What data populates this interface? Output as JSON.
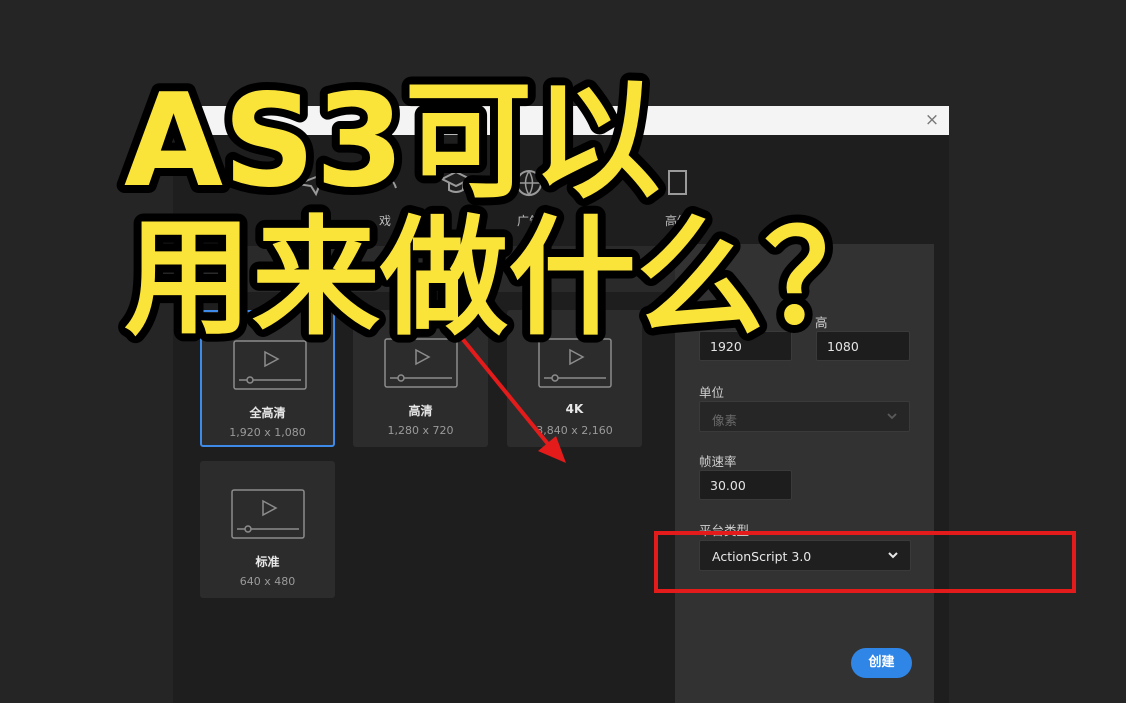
{
  "overlay": {
    "line1": "AS3可以",
    "line2": "用来做什么？"
  },
  "dialog": {
    "close_glyph": "×",
    "categories": [
      {
        "label": "",
        "icon": "person-icon"
      },
      {
        "label": "",
        "icon": "paper-plane-icon"
      },
      {
        "label": "戏",
        "icon": "game-icon"
      },
      {
        "label": "",
        "icon": "graduation-cap-icon"
      },
      {
        "label": "广告",
        "icon": "globe-icon"
      },
      {
        "label": "高级",
        "icon": "document-icon"
      }
    ],
    "presets": [
      {
        "name": "全高清",
        "size": "1,920 x 1,080",
        "selected": true
      },
      {
        "name": "高清",
        "size": "1,280 x 720",
        "selected": false
      },
      {
        "name": "4K",
        "size": "3,840 x 2,160",
        "selected": false
      },
      {
        "name": "标准",
        "size": "640 x 480",
        "selected": false
      }
    ],
    "details": {
      "height_label": "高",
      "width_value": "1920",
      "height_value": "1080",
      "unit_label": "单位",
      "unit_value": "像素",
      "fps_label": "帧速率",
      "fps_value": "30.00",
      "platform_label": "平台类型",
      "platform_value": "ActionScript 3.0",
      "create_label": "创建"
    }
  },
  "colors": {
    "accent": "#2f86e6",
    "highlight": "#e31b1b",
    "title_fill": "#fbe43a"
  }
}
